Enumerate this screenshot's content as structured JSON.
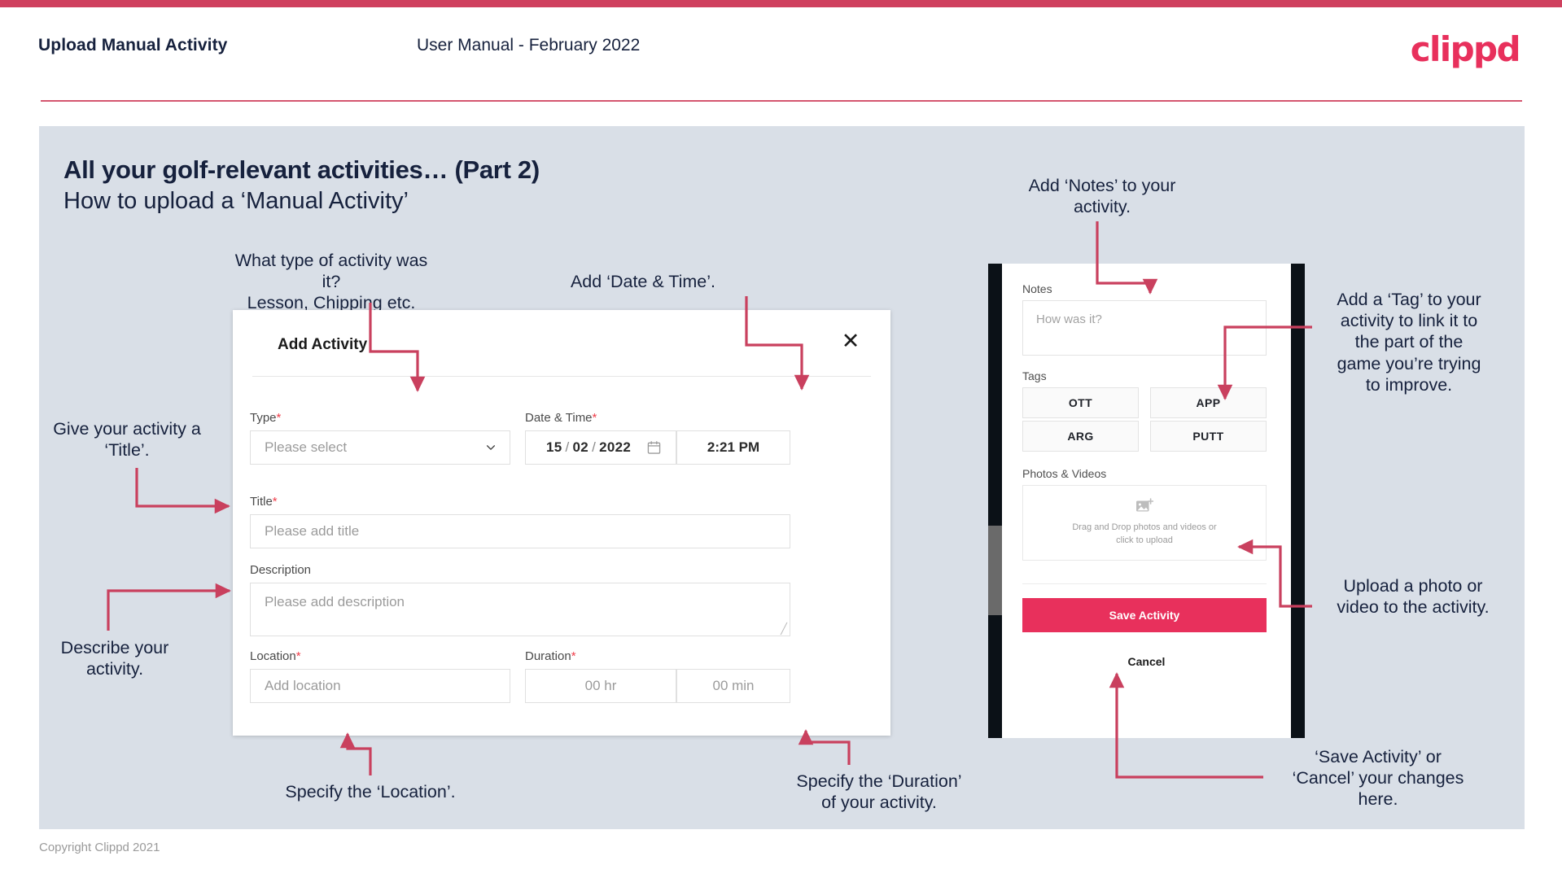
{
  "colors": {
    "accent_pink": "#e8305c",
    "accent_bar": "#cf405e",
    "slide_bg": "#d9dfe7",
    "text_dark": "#16213d",
    "arrow": "#c9405e"
  },
  "header": {
    "title": "Upload Manual Activity",
    "subtitle": "User Manual - February 2022",
    "logo": "clippd"
  },
  "slide": {
    "title": "All your golf-relevant activities… (Part 2)",
    "subtitle": "How to upload a ‘Manual Activity’"
  },
  "callouts": {
    "type": "What type of activity was it?\nLesson, Chipping etc.",
    "datetime": "Add ‘Date & Time’.",
    "title_field": "Give your activity a\n‘Title’.",
    "description": "Describe your\nactivity.",
    "location": "Specify the ‘Location’.",
    "duration": "Specify the ‘Duration’\nof your activity.",
    "notes": "Add ‘Notes’ to your\nactivity.",
    "tag": "Add a ‘Tag’ to your\nactivity to link it to\nthe part of the\ngame you’re trying\nto improve.",
    "upload": "Upload a photo or\nvideo to the activity.",
    "save": "‘Save Activity’ or\n‘Cancel’ your changes\nhere."
  },
  "dialog": {
    "title": "Add Activity",
    "close_icon": "close-icon",
    "fields": {
      "type": {
        "label": "Type",
        "required": "*",
        "placeholder": "Please select",
        "icon": "chevron-down-icon"
      },
      "datetime": {
        "label": "Date & Time",
        "required": "*",
        "day": "15",
        "month": "02",
        "year": "2022",
        "separator": "/",
        "icon": "calendar-icon",
        "time": "2:21 PM"
      },
      "title": {
        "label": "Title",
        "required": "*",
        "placeholder": "Please add title"
      },
      "description": {
        "label": "Description",
        "required": "",
        "placeholder": "Please add description"
      },
      "location": {
        "label": "Location",
        "required": "*",
        "placeholder": "Add location"
      },
      "duration": {
        "label": "Duration",
        "required": "*",
        "hours_placeholder": "00 hr",
        "minutes_placeholder": "00 min"
      }
    }
  },
  "phone": {
    "notes": {
      "label": "Notes",
      "placeholder": "How was it?"
    },
    "tags": {
      "label": "Tags",
      "items": [
        "OTT",
        "APP",
        "ARG",
        "PUTT"
      ]
    },
    "photos": {
      "label": "Photos & Videos",
      "icon": "add-image-icon",
      "drop_text": "Drag and Drop photos and videos or click to upload"
    },
    "save_label": "Save Activity",
    "cancel_label": "Cancel"
  },
  "footer": {
    "copyright": "Copyright Clippd 2021"
  }
}
